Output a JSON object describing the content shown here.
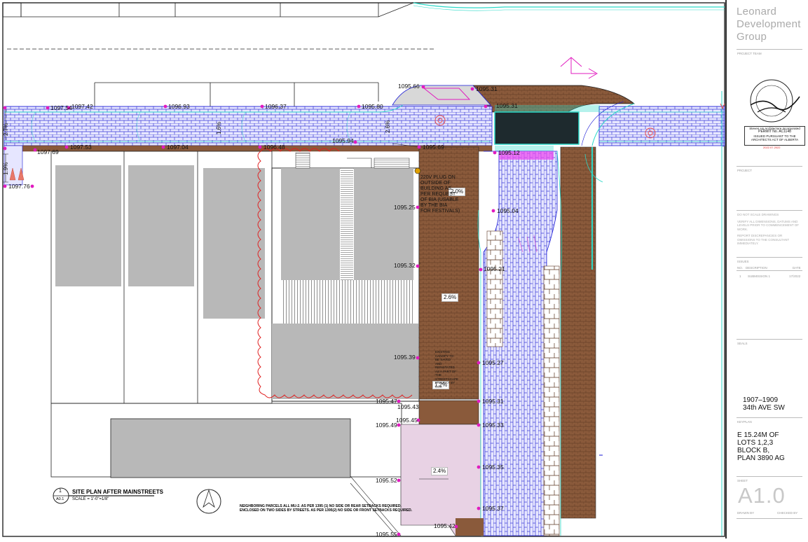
{
  "drawing": {
    "elevations": [
      {
        "id": "e1",
        "text": "1095.66"
      },
      {
        "id": "e2",
        "text": "1095.31"
      },
      {
        "id": "e3",
        "text": "1097.54"
      },
      {
        "id": "e4",
        "text": "1097.42"
      },
      {
        "id": "e5",
        "text": "1096.93"
      },
      {
        "id": "e6",
        "text": "1096.37"
      },
      {
        "id": "e7",
        "text": "1095.80"
      },
      {
        "id": "e8",
        "text": "1095.31"
      },
      {
        "id": "e9",
        "text": "1097.69"
      },
      {
        "id": "e10",
        "text": "1097.53"
      },
      {
        "id": "e11",
        "text": "1097.04"
      },
      {
        "id": "e12",
        "text": "1096.48"
      },
      {
        "id": "e13",
        "text": "1095.94"
      },
      {
        "id": "e14",
        "text": "1095.69"
      },
      {
        "id": "e15",
        "text": "1095.12"
      },
      {
        "id": "e16",
        "text": "1097.76"
      },
      {
        "id": "e17",
        "text": "1095.25"
      },
      {
        "id": "e18",
        "text": "1095.04"
      },
      {
        "id": "e19",
        "text": "1095.32"
      },
      {
        "id": "e20",
        "text": "1095.21"
      },
      {
        "id": "e21",
        "text": "1095.39"
      },
      {
        "id": "e22",
        "text": "1095.27"
      },
      {
        "id": "e23",
        "text": "1095.47"
      },
      {
        "id": "e24",
        "text": "1095.43"
      },
      {
        "id": "e25",
        "text": "1095.31"
      },
      {
        "id": "e26",
        "text": "1095.45"
      },
      {
        "id": "e27",
        "text": "1095.49"
      },
      {
        "id": "e28",
        "text": "1095.33"
      },
      {
        "id": "e29",
        "text": "1095.35"
      },
      {
        "id": "e30",
        "text": "1095.52"
      },
      {
        "id": "e31",
        "text": "1095.37"
      },
      {
        "id": "e32",
        "text": "1095.42"
      },
      {
        "id": "e33",
        "text": "1095.55"
      }
    ],
    "slopes": {
      "s_2_0": "2.0%",
      "s_2_6": "2.6%",
      "s_1_2": "1.2%",
      "s_2_4": "2.4%",
      "v_2_7": "2.7%",
      "v_1_6": "1.6%",
      "v_2_6": "2.6%",
      "v_1_9": "1.9%"
    },
    "plug_note": [
      "220V PLUG ON",
      "OUTSIDE OF",
      "BUILDING AS",
      "PER REQUEST",
      "OF BIA (USABLE",
      "BY THE BIA",
      "FOR FESTIVALS)"
    ],
    "existing_note": [
      "EXISTING",
      "CANOPY TO",
      "BE SAVED",
      "AND",
      "REINSTATED",
      "AS A PART OF",
      "THE",
      "STREETSCAPE",
      "PROJECT BY",
      "COC"
    ],
    "view_title": "SITE PLAN AFTER MAINSTREETS",
    "view_scale": "SCALE = 1'-0\"=1/8\"",
    "view_number": "1",
    "view_sheet": "A0.1",
    "zoning_note": [
      "NEIGHBORING PARCELS ALL MU-2. AS PER 1395 (1) NO SIDE OR REAR SETBACKS REQUIRED.",
      "ENCLOSED ON TWO SIDES BY STREETS. AS PER 1395(2) NO SIDE OR FRONT SETBACKS REQUIRED."
    ]
  },
  "title_block": {
    "firm": "Leonard Development Group",
    "project_team_label": "PROJECT TEAM",
    "stamp_lines": [
      "Steven Ho Architecture Incorporated",
      "PERMIT No. AC1148",
      "ISSUED PURSUANT TO THE",
      "ARCHITECTS ACT OF ALBERTA"
    ],
    "stamp_date": "2022.07.2022",
    "project_label": "PROJECT",
    "disclaimer": [
      "DO NOT SCALE DRAWINGS",
      "VERIFY ALL DIMENSIONS, DATUMS AND",
      "LEVELS PRIOR TO COMMENCEMENT OF",
      "WORK.",
      "REPORT DISCREPANCIES OR",
      "OMISSIONS TO THE CONSULTANT",
      "IMMEDIATELY."
    ],
    "issues_label": "ISSUES",
    "issues_header": {
      "no": "NO.",
      "desc": "DESCRIPTION",
      "date": "DATE"
    },
    "issue_row": {
      "no": "1",
      "desc": "SUBMISSION 1",
      "date": "17/2022"
    },
    "seals_label": "SEALS",
    "address": [
      "1907–1909",
      "34th AVE SW"
    ],
    "keyplan_label": "KEYPLAN",
    "legal": [
      "E 15.24M OF",
      "LOTS 1,2,3",
      "BLOCK B,",
      "PLAN 3890 AG"
    ],
    "sheet_label": "SHEET",
    "sheet_number": "A1.0",
    "drawn_by_label": "DRAWN BY",
    "checked_by_label": "CHECKED BY"
  }
}
